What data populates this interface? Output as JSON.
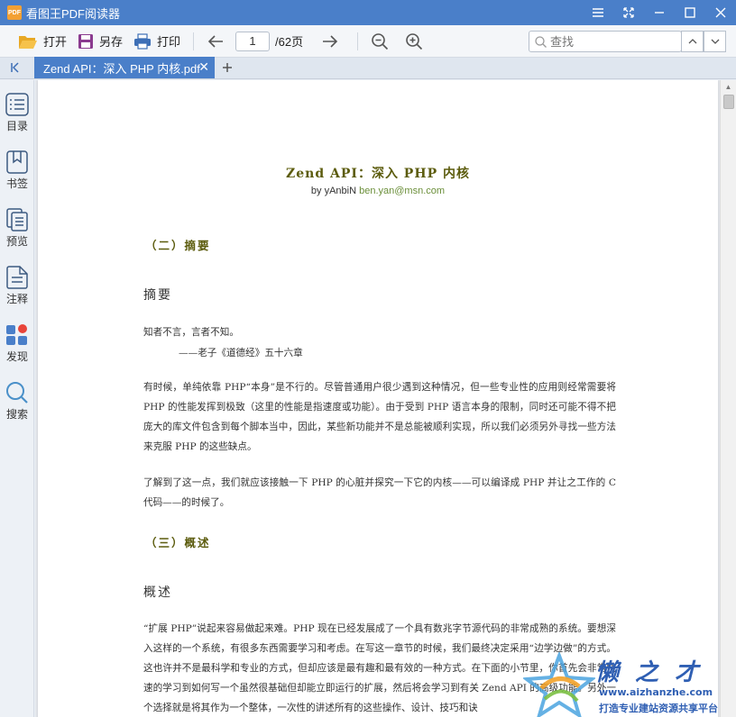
{
  "app": {
    "title": "看图王PDF阅读器",
    "logo_text": "PDF"
  },
  "toolbar": {
    "open_label": "打开",
    "saveas_label": "另存",
    "print_label": "打印",
    "page_value": "1",
    "page_total": "/62页",
    "search_placeholder": "查找"
  },
  "tabs": [
    {
      "label": "Zend API：深入 PHP 内核.pdf"
    }
  ],
  "sidebar": {
    "items": [
      {
        "label": "目录",
        "icon": "list-icon"
      },
      {
        "label": "书签",
        "icon": "bookmark-icon"
      },
      {
        "label": "预览",
        "icon": "preview-icon"
      },
      {
        "label": "注释",
        "icon": "note-icon"
      },
      {
        "label": "发现",
        "icon": "discover-icon"
      },
      {
        "label": "搜索",
        "icon": "search-icon"
      }
    ]
  },
  "document": {
    "title": "Zend API：深入  PHP  内核",
    "author_prefix": "by yAnbiN ",
    "author_email": "ben.yan@msn.com",
    "section2": "（二）摘要",
    "heading_abstract": "摘要",
    "quote_line1": "知者不言，言者不知。",
    "quote_line2": "——老子《道德经》五十六章",
    "para1": "有时候，单纯依靠 PHP“本身”是不行的。尽管普通用户很少遇到这种情况，但一些专业性的应用则经常需要将 PHP 的性能发挥到极致（这里的性能是指速度或功能）。由于受到 PHP 语言本身的限制，同时还可能不得不把庞大的库文件包含到每个脚本当中，因此，某些新功能并不是总能被顺利实现，所以我们必须另外寻找一些方法来克服 PHP 的这些缺点。",
    "para2": "了解到了这一点，我们就应该接触一下 PHP 的心脏并探究一下它的内核——可以编译成 PHP 并让之工作的 C 代码——的时候了。",
    "section3": "（三）概述",
    "heading_overview": "概述",
    "para3": "“扩展 PHP”说起来容易做起来难。PHP 现在已经发展成了一个具有数兆字节源代码的非常成熟的系统。要想深入这样的一个系统，有很多东西需要学习和考虑。在写这一章节的时候，我们最终决定采用“边学边做”的方式。这也许并不是最科学和专业的方式，但却应该是最有趣和最有效的一种方式。在下面的小节里，你首先会非常快速的学习到如何写一个虽然很基础但却能立即运行的扩展，然后将会学习到有关 Zend API 的高级功能。另外一个选择就是将其作为一个整体，一次性的讲述所有的这些操作、设计、技巧和诀"
  },
  "watermark": {
    "chars": "懒之才",
    "url": "www.aizhanzhe.com",
    "slogan": "打造专业建站资源共享平台"
  },
  "colors": {
    "accent": "#4a7fc9",
    "heading": "#5c5c0e",
    "link": "#6b8f3a"
  }
}
